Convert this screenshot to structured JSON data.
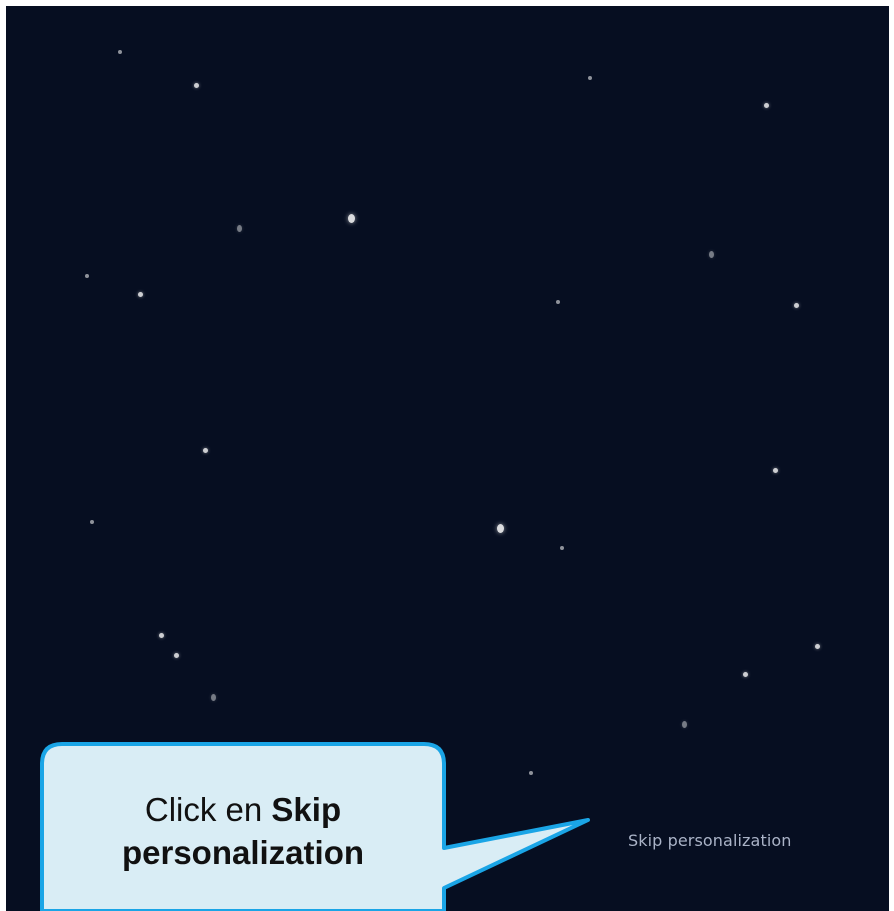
{
  "screen": {
    "background": "#060e21",
    "skip_link": "Skip personalization",
    "skip_link_color": "#aab3c7"
  },
  "callout": {
    "prefix": "Click en ",
    "bold_line1": "Skip",
    "bold_line2": "personalization",
    "fill": "#d9edf5",
    "border": "#1aa5e6"
  }
}
